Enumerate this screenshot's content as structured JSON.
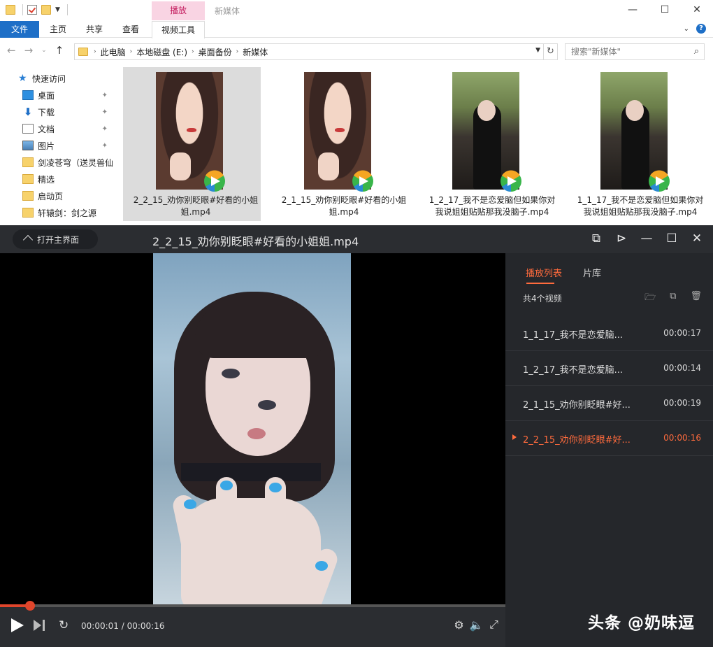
{
  "explorer": {
    "window_title": "新媒体",
    "context_tab": "播放",
    "ribbon_tabs": [
      "文件",
      "主页",
      "共享",
      "查看",
      "视频工具"
    ],
    "address": {
      "crumbs": [
        "此电脑",
        "本地磁盘 (E:)",
        "桌面备份",
        "新媒体"
      ]
    },
    "search_placeholder": "搜索\"新媒体\"",
    "nav": {
      "quick_access": "快速访问",
      "items": [
        {
          "label": "桌面",
          "icon": "desktop-icon",
          "pinned": true
        },
        {
          "label": "下载",
          "icon": "download-icon",
          "pinned": true
        },
        {
          "label": "文档",
          "icon": "document-icon",
          "pinned": true
        },
        {
          "label": "图片",
          "icon": "pictures-icon",
          "pinned": true
        },
        {
          "label": "剑凌苍穹（送灵兽仙",
          "icon": "folder-icon",
          "pinned": false
        },
        {
          "label": "精选",
          "icon": "folder-icon",
          "pinned": false
        },
        {
          "label": "启动页",
          "icon": "folder-icon",
          "pinned": false
        },
        {
          "label": "轩辕剑：剑之源",
          "icon": "folder-icon",
          "pinned": false
        }
      ]
    },
    "files": [
      {
        "name_line1": "2_2_15_劝你别眨眼#好看的小姐",
        "name_line2": "姐.mp4",
        "selected": true,
        "thumb": "face"
      },
      {
        "name_line1": "2_1_15_劝你别眨眼#好看的小姐",
        "name_line2": "姐.mp4",
        "selected": false,
        "thumb": "face"
      },
      {
        "name_line1": "1_2_17_我不是恋爱脑但如果你对",
        "name_line2": "我说姐姐贴贴那我没脑子.mp4",
        "selected": false,
        "thumb": "park"
      },
      {
        "name_line1": "1_1_17_我不是恋爱脑但如果你对",
        "name_line2": "我说姐姐贴贴那我没脑子.mp4",
        "selected": false,
        "thumb": "park"
      }
    ]
  },
  "player": {
    "home_label": "打开主界面",
    "title": "2_2_15_劝你别眨眼#好看的小姐姐.mp4",
    "time_current": "00:00:01",
    "time_sep": " / ",
    "time_total": "00:00:16",
    "progress_fraction": 0.06,
    "playlist": {
      "tab_playlist": "播放列表",
      "tab_library": "片库",
      "count": "共4个视频",
      "items": [
        {
          "title": "1_1_17_我不是恋爱脑...",
          "duration": "00:00:17",
          "current": false
        },
        {
          "title": "1_2_17_我不是恋爱脑...",
          "duration": "00:00:14",
          "current": false
        },
        {
          "title": "2_1_15_劝你别眨眼#好...",
          "duration": "00:00:19",
          "current": false
        },
        {
          "title": "2_2_15_劝你别眨眼#好...",
          "duration": "00:00:16",
          "current": true
        }
      ]
    },
    "accent_color": "#ff6b3d"
  },
  "watermark": "头条 @奶味逗"
}
